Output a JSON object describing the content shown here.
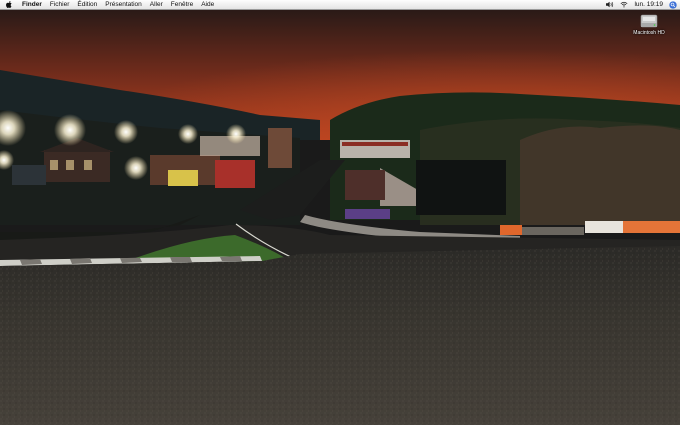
{
  "menubar": {
    "items": [
      {
        "label": "Finder",
        "bold": true
      },
      {
        "label": "Fichier"
      },
      {
        "label": "Édition"
      },
      {
        "label": "Présentation"
      },
      {
        "label": "Aller"
      },
      {
        "label": "Fenêtre"
      },
      {
        "label": "Aide"
      }
    ],
    "status_icons": [
      "volume-icon",
      "wifi-icon",
      "search-icon"
    ],
    "clock": "lun. 19:19"
  },
  "desktop": {
    "icons": [
      {
        "label": "Macintosh HD",
        "icon": "hard-drive-icon"
      }
    ]
  },
  "colors": {
    "sky_top": "#2a1a17",
    "sky_glow": "#b8411f",
    "track": "#3a3631"
  }
}
